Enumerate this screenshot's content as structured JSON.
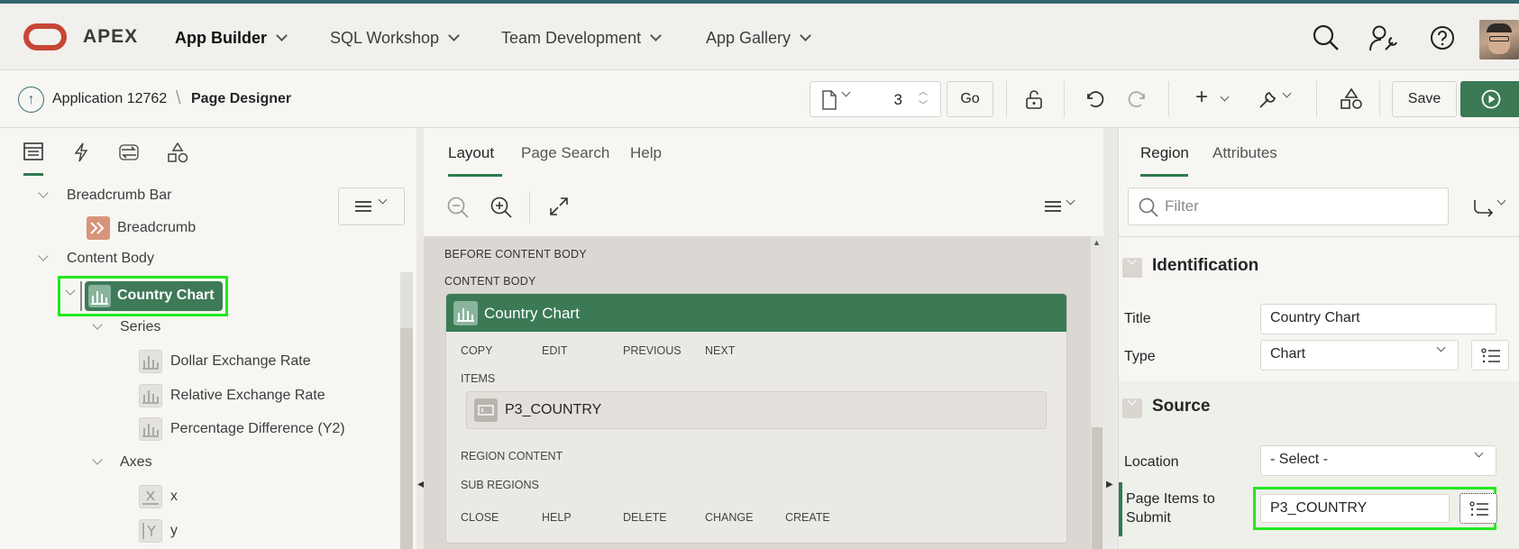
{
  "header": {
    "brand": "APEX",
    "nav": [
      {
        "label": "App Builder",
        "active": true
      },
      {
        "label": "SQL Workshop",
        "active": false
      },
      {
        "label": "Team Development",
        "active": false
      },
      {
        "label": "App Gallery",
        "active": false
      }
    ]
  },
  "toolbar": {
    "breadcrumb_app": "Application 12762",
    "breadcrumb_sep": "\\",
    "breadcrumb_page": "Page Designer",
    "page_number": "3",
    "go_label": "Go",
    "save_label": "Save"
  },
  "left": {
    "tree": {
      "breadcrumb_bar": "Breadcrumb Bar",
      "breadcrumb": "Breadcrumb",
      "content_body": "Content Body",
      "country_chart": "Country Chart",
      "series": "Series",
      "series_items": [
        "Dollar Exchange Rate",
        "Relative Exchange Rate",
        "Percentage Difference (Y2)"
      ],
      "axes": "Axes",
      "axis_items": [
        "x",
        "y"
      ]
    }
  },
  "center": {
    "tabs": [
      "Layout",
      "Page Search",
      "Help"
    ],
    "before_content_body": "BEFORE CONTENT BODY",
    "content_body": "CONTENT BODY",
    "region": {
      "title": "Country Chart",
      "actions_top": [
        "COPY",
        "EDIT",
        "PREVIOUS",
        "NEXT"
      ],
      "items_label": "ITEMS",
      "item": "P3_COUNTRY",
      "region_content": "REGION CONTENT",
      "sub_regions": "SUB REGIONS",
      "actions_bottom": [
        "CLOSE",
        "HELP",
        "DELETE",
        "CHANGE",
        "CREATE"
      ]
    }
  },
  "right": {
    "tabs": [
      "Region",
      "Attributes"
    ],
    "filter_placeholder": "Filter",
    "identification": {
      "header": "Identification",
      "title_label": "Title",
      "title_value": "Country Chart",
      "type_label": "Type",
      "type_value": "Chart"
    },
    "source": {
      "header": "Source",
      "location_label": "Location",
      "location_value": "- Select -",
      "items_submit_label": "Page Items to Submit",
      "items_submit_value": "P3_COUNTRY"
    }
  },
  "colors": {
    "accent_green": "#3b7a55",
    "highlight": "#22e81e",
    "oracle_red": "#c74634",
    "top_stripe": "#34666f"
  }
}
